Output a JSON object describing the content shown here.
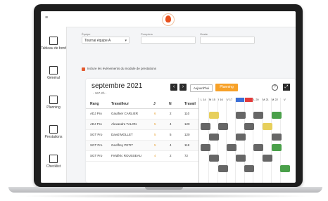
{
  "header": {
    "menu_icon": "menu-icon",
    "logo_icon": "flame-logo-icon"
  },
  "sidebar": {
    "items": [
      {
        "label": "Tableau de bord",
        "icon": "dashboard-icon"
      },
      {
        "label": "Général",
        "icon": "general-icon"
      },
      {
        "label": "Planning",
        "icon": "calendar-icon"
      },
      {
        "label": "Prestations",
        "icon": "prestations-icon"
      },
      {
        "label": "Checklist",
        "icon": "checklist-icon"
      }
    ]
  },
  "filters": {
    "equipe_label": "Équipe",
    "equipe_value": "Tournai équipe A",
    "pompiers_label": "Pompiers",
    "grade_label": "Grade",
    "include_label": "Inclure les événements du module de prestations"
  },
  "calendar": {
    "month": "septembre 2021",
    "hours": "- 167.2h -",
    "today_label": "Aujourd'hui",
    "planning_label": "Planning",
    "prev_icon": "chevron-left-icon",
    "next_icon": "chevron-right-icon",
    "help_icon": "help-icon",
    "expand_icon": "expand-icon"
  },
  "table": {
    "headers": [
      "Rang",
      "Travailleur",
      "J",
      "N",
      "Travail"
    ],
    "rows": [
      {
        "rang": "ADJ Pro",
        "name": "Gauthier CARLIER",
        "j": "6",
        "n": "2",
        "travail": "110"
      },
      {
        "rang": "ADJ Pro",
        "name": "Alexandre TALON",
        "j": "5",
        "n": "4",
        "travail": "120"
      },
      {
        "rang": "SGT Pro",
        "name": "David MOLLET",
        "j": "5",
        "n": "5",
        "travail": "120"
      },
      {
        "rang": "SGT Pro",
        "name": "Geoffrey PETIT",
        "j": "5",
        "n": "4",
        "travail": "118"
      },
      {
        "rang": "SGT Pro",
        "name": "Frédéric ROUSSEAU",
        "j": "4",
        "n": "2",
        "travail": "72"
      }
    ]
  },
  "day_headers": [
    "L 14",
    "M 15",
    "I 16",
    "V 17",
    "",
    "",
    "L 20",
    "M 21",
    "M 22",
    "V"
  ],
  "colors": {
    "accent": "#f7a128",
    "brand_red": "#e8501c",
    "dark": "#2b2b2b"
  }
}
